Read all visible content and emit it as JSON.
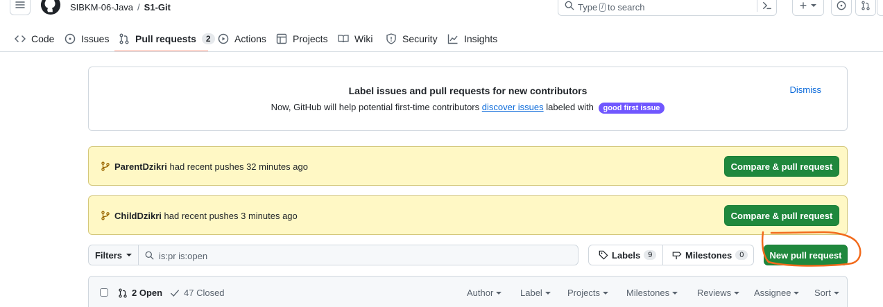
{
  "header": {
    "owner": "SIBKM-06-Java",
    "separator": "/",
    "repo": "S1-Git",
    "search_placeholder_before": "Type",
    "search_key": "/",
    "search_placeholder_after": "to search",
    "plus_label": "+"
  },
  "tabs": [
    {
      "label": "Code"
    },
    {
      "label": "Issues"
    },
    {
      "label": "Pull requests",
      "count": "2"
    },
    {
      "label": "Actions"
    },
    {
      "label": "Projects"
    },
    {
      "label": "Wiki"
    },
    {
      "label": "Security"
    },
    {
      "label": "Insights"
    }
  ],
  "banner": {
    "title": "Label issues and pull requests for new contributors",
    "desc_before": "Now, GitHub will help potential first-time contributors",
    "desc_link": "discover issues",
    "desc_after": "labeled with",
    "pill": "good first issue",
    "dismiss": "Dismiss"
  },
  "pushes": [
    {
      "branch": "ParentDzikri",
      "text": "had recent pushes 32 minutes ago",
      "button": "Compare & pull request"
    },
    {
      "branch": "ChildDzikri",
      "text": "had recent pushes 3 minutes ago",
      "button": "Compare & pull request"
    }
  ],
  "filters": {
    "button": "Filters",
    "query": "is:pr is:open",
    "labels": "Labels",
    "labels_count": "9",
    "milestones": "Milestones",
    "milestones_count": "0",
    "new_pr": "New pull request"
  },
  "list": {
    "open": "2 Open",
    "closed": "47 Closed",
    "sorts": [
      "Author",
      "Label",
      "Projects",
      "Milestones",
      "Reviews",
      "Assignee",
      "Sort"
    ]
  },
  "colors": {
    "green": "#1f883d",
    "accent_underline": "#fd8c73",
    "notice_bg": "#fff8c5",
    "pill": "#7057ff",
    "annotation": "#f26a1b"
  }
}
